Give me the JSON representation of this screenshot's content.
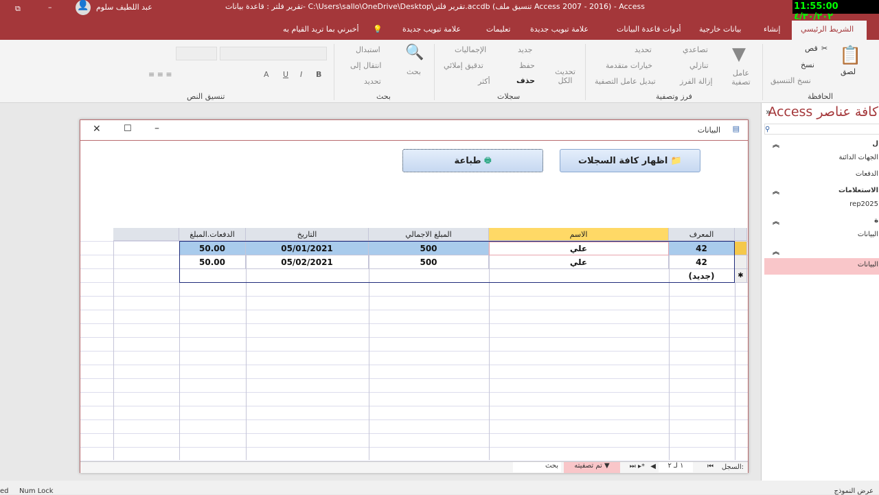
{
  "titlebar": {
    "title": "تقرير فلتر : قاعدة بيانات- C:\\Users\\sallo\\OneDrive\\Desktop\\تقرير فلتر.accdb (تنسيق ملف Access 2007 - 2016) - Access",
    "user": "عبد اللطيف سلوم",
    "clock": "11:55:00 ٤/٣٠/٢٠٢"
  },
  "tabs": [
    "الشريط الرئيسي",
    "إنشاء",
    "بيانات خارجية",
    "أدوات قاعدة البيانات",
    "علامة تبويب جديدة",
    "تعليمات",
    "علامة تبويب جديدة",
    "أخبرني بما تريد القيام به"
  ],
  "ribbon": {
    "clipboard": {
      "label": "الحافظة",
      "paste": "لصق",
      "cut": "قص",
      "copy": "نسخ",
      "format_painter": "نسخ التنسيق"
    },
    "sort_filter": {
      "label": "فرز وتصفية",
      "filter": "عامل تصفية",
      "ascending": "تصاعدي",
      "descending": "تنازلي",
      "remove_sort": "إزالة الفرز",
      "selection": "تحديد",
      "advanced": "خيارات متقدمة",
      "toggle_filter": "تبديل عامل التصفية"
    },
    "records": {
      "label": "سجلات",
      "refresh": "تحديث الكل",
      "new": "جديد",
      "save": "حفظ",
      "delete": "حذف",
      "totals": "الإجماليات",
      "spelling": "تدقيق إملائي",
      "more": "أكثر"
    },
    "find": {
      "label": "بحث",
      "find": "بحث",
      "replace": "استبدال",
      "goto": "انتقال إلى",
      "select": "تحديد"
    },
    "text_format": {
      "label": "تنسيق النص",
      "bold": "B",
      "italic": "I",
      "underline": "U",
      "font_a": "A"
    }
  },
  "nav": {
    "title": "كافة عناصر Access",
    "items": [
      {
        "label": "ل",
        "type": "group"
      },
      {
        "label": "الجهات الدائنة",
        "type": "item"
      },
      {
        "label": "الدفعات",
        "type": "item"
      },
      {
        "label": "الاستعلامات",
        "type": "group"
      },
      {
        "label": "rep2025",
        "type": "item"
      },
      {
        "label": "ة",
        "type": "group"
      },
      {
        "label": "البيانات",
        "type": "item"
      },
      {
        "label": "",
        "type": "group"
      },
      {
        "label": "البيانات",
        "type": "item",
        "selected": true
      }
    ]
  },
  "form": {
    "title": "البيانات",
    "show_all_button": "اظهار كافة السجلات",
    "print_button": "طباعة",
    "columns": [
      "المعرف",
      "الاسم",
      "المبلغ الاجمالي",
      "التاريخ",
      "الدفعات.المبلغ"
    ],
    "rows": [
      [
        "42",
        "علي",
        "500",
        "05/01/2021",
        "50.00"
      ],
      [
        "42",
        "علي",
        "500",
        "05/02/2021",
        "50.00"
      ]
    ],
    "new_row_label": "(جديد)",
    "navigator": {
      "label": "السجل:",
      "position": "١ لـ ٢",
      "filtered": "تم تصفيته",
      "search": "بحث"
    }
  },
  "statusbar": {
    "left1": "ed",
    "left2": "Num Lock",
    "right": "عرض النموذج"
  },
  "colors": {
    "accent": "#a4373a",
    "selected_row": "#a9cbec",
    "filter_header": "#ffd966",
    "filtered_badge": "#f9c6c9"
  }
}
